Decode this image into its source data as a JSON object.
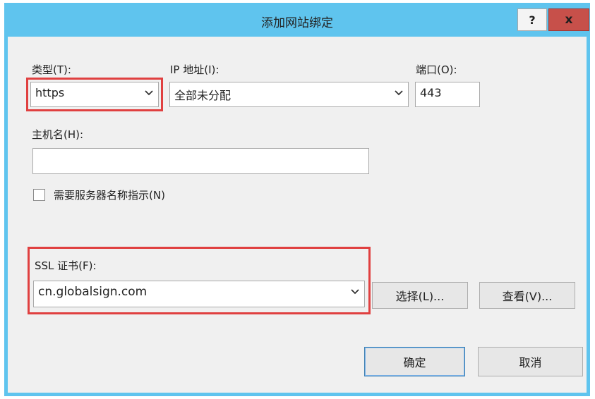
{
  "window": {
    "title": "添加网站绑定",
    "help_label": "?",
    "close_label": "x"
  },
  "type_field": {
    "label": "类型(T):",
    "value": "https"
  },
  "ip_field": {
    "label": "IP 地址(I):",
    "value": "全部未分配"
  },
  "port_field": {
    "label": "端口(O):",
    "value": "443"
  },
  "hostname_field": {
    "label": "主机名(H):",
    "value": ""
  },
  "sni_checkbox": {
    "label": "需要服务器名称指示(N)",
    "checked": false
  },
  "ssl_field": {
    "label": "SSL 证书(F):",
    "value": "cn.globalsign.com",
    "select_button": "选择(L)...",
    "view_button": "查看(V)..."
  },
  "footer": {
    "ok_label": "确定",
    "cancel_label": "取消"
  },
  "colors": {
    "title_bar": "#5fc4ee",
    "close_button": "#c7504a",
    "highlight": "#e04040",
    "client_bg": "#f0f0f0"
  },
  "icons": {
    "combo_arrow": "chevron-down-icon"
  }
}
